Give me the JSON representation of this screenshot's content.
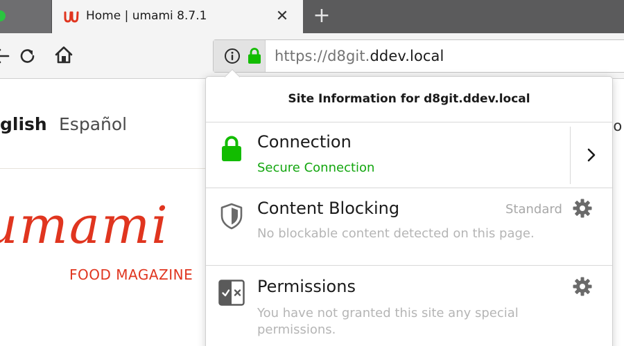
{
  "browser": {
    "tab": {
      "title": "Home | umami 8.7.1",
      "favicon": "umami-logo-icon",
      "close_icon": "close-icon"
    },
    "new_tab_icon": "plus-icon",
    "nav": {
      "back_icon": "back-arrow-icon",
      "reload_icon": "reload-icon",
      "home_icon": "home-icon"
    },
    "urlbar": {
      "prefix": "https://d8git.",
      "domain": "ddev.local",
      "info_icon": "info-icon",
      "lock_icon": "lock-icon"
    }
  },
  "page": {
    "languages": [
      "glish",
      "Español"
    ],
    "brand": {
      "wordmark": "umami",
      "tagline": "FOOD MAGAZINE"
    },
    "right_fragment": "vo"
  },
  "site_info": {
    "title": "Site Information for d8git.ddev.local",
    "connection": {
      "title": "Connection",
      "status": "Secure Connection",
      "icon": "lock-icon",
      "more_icon": "chevron-right-icon"
    },
    "content_blocking": {
      "title": "Content Blocking",
      "level": "Standard",
      "description": "No blockable content detected on this page.",
      "icon": "shield-icon",
      "settings_icon": "gear-icon"
    },
    "permissions": {
      "title": "Permissions",
      "description": "You have not granted this site any special permissions.",
      "icon": "permissions-icon",
      "settings_icon": "gear-icon"
    }
  },
  "colors": {
    "secure_green": "#12a60e",
    "lock_green": "#12bc00",
    "brand_red": "#e0351f",
    "tabstrip": "#5b5b5c"
  }
}
